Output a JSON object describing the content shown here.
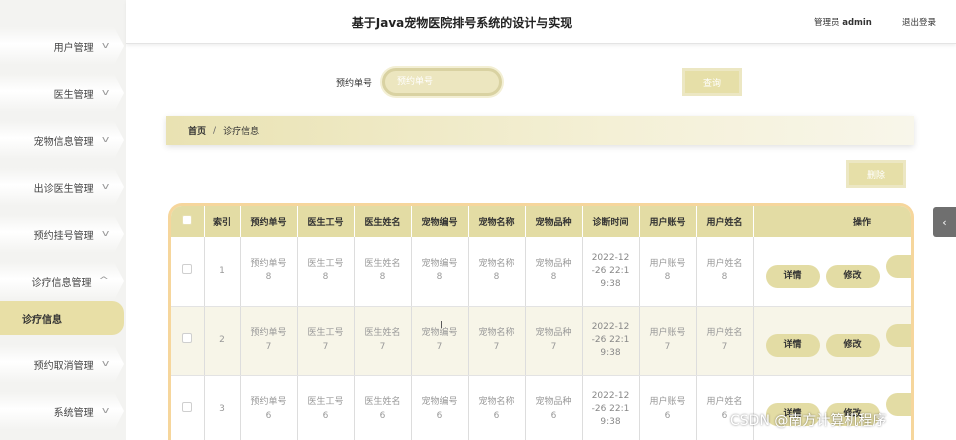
{
  "app_title": "基于Java宠物医院排号系统的设计与实现",
  "header": {
    "role_label": "管理员",
    "username": "admin",
    "logout": "退出登录"
  },
  "sidebar": {
    "items": [
      {
        "label": "用户管理",
        "chevron": "chevron-down-icon"
      },
      {
        "label": "医生管理",
        "chevron": "chevron-down-icon"
      },
      {
        "label": "宠物信息管理",
        "chevron": "chevron-down-icon"
      },
      {
        "label": "出诊医生管理",
        "chevron": "chevron-down-icon"
      },
      {
        "label": "预约挂号管理",
        "chevron": "chevron-down-icon"
      },
      {
        "label": "诊疗信息管理",
        "chevron": "chevron-up-icon"
      },
      {
        "label": "预约取消管理",
        "chevron": "chevron-down-icon"
      },
      {
        "label": "系统管理",
        "chevron": "chevron-down-icon"
      }
    ],
    "active_sub": "诊疗信息"
  },
  "search": {
    "label": "预约单号",
    "placeholder": "预约单号",
    "button": "查询"
  },
  "breadcrumb": {
    "home": "首页",
    "current": "诊疗信息"
  },
  "delete_button": "删除",
  "table": {
    "headers": [
      "索引",
      "预约单号",
      "医生工号",
      "医生姓名",
      "宠物编号",
      "宠物名称",
      "宠物品种",
      "诊断时间",
      "用户账号",
      "用户姓名",
      "操作"
    ],
    "rows": [
      {
        "index": "1",
        "cells": [
          [
            "预约单号",
            "8"
          ],
          [
            "医生工号",
            "8"
          ],
          [
            "医生姓名",
            "8"
          ],
          [
            "宠物编号",
            "8"
          ],
          [
            "宠物名称",
            "8"
          ],
          [
            "宠物品种",
            "8"
          ],
          [
            "2022-12",
            "-26 22:1",
            "9:38"
          ],
          [
            "用户账号",
            "8"
          ],
          [
            "用户姓名",
            "8"
          ]
        ]
      },
      {
        "index": "2",
        "cells": [
          [
            "预约单号",
            "7"
          ],
          [
            "医生工号",
            "7"
          ],
          [
            "医生姓名",
            "7"
          ],
          [
            "宠物编号",
            "7"
          ],
          [
            "宠物名称",
            "7"
          ],
          [
            "宠物品种",
            "7"
          ],
          [
            "2022-12",
            "-26 22:1",
            "9:38"
          ],
          [
            "用户账号",
            "7"
          ],
          [
            "用户姓名",
            "7"
          ]
        ]
      },
      {
        "index": "3",
        "cells": [
          [
            "预约单号",
            "6"
          ],
          [
            "医生工号",
            "6"
          ],
          [
            "医生姓名",
            "6"
          ],
          [
            "宠物编号",
            "6"
          ],
          [
            "宠物名称",
            "6"
          ],
          [
            "宠物品种",
            "6"
          ],
          [
            "2022-12",
            "-26 22:1",
            "9:38"
          ],
          [
            "用户账号",
            "6"
          ],
          [
            "用户姓名",
            "6"
          ]
        ]
      }
    ],
    "actions": {
      "detail": "详情",
      "edit": "修改"
    }
  },
  "side_tab_icon": "chevron-left-icon",
  "side_tab_glyph": "‹",
  "watermark": "CSDN @南方计算机程序",
  "colors": {
    "accent": "#e3dca4",
    "active_nav": "#e8dfa6",
    "table_border": "#f6d69c"
  }
}
